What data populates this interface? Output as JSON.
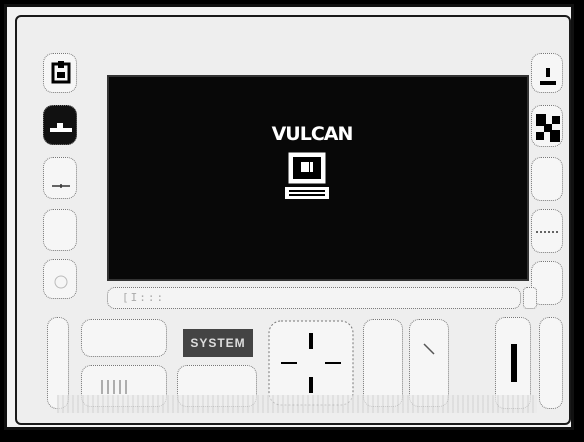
{
  "screen": {
    "title": "VULCAN",
    "icon": "computer-icon"
  },
  "status_strip": {
    "text": "[I:::"
  },
  "keypad": {
    "function_label": "SYSTEM"
  },
  "left_keys": [
    "disk-icon",
    "ship-icon",
    "line-icon",
    "blank-key",
    "blank-key"
  ],
  "right_keys": [
    "person-icon",
    "stairs-icon",
    "blank-key",
    "dotted-line-icon",
    "blank-key"
  ]
}
